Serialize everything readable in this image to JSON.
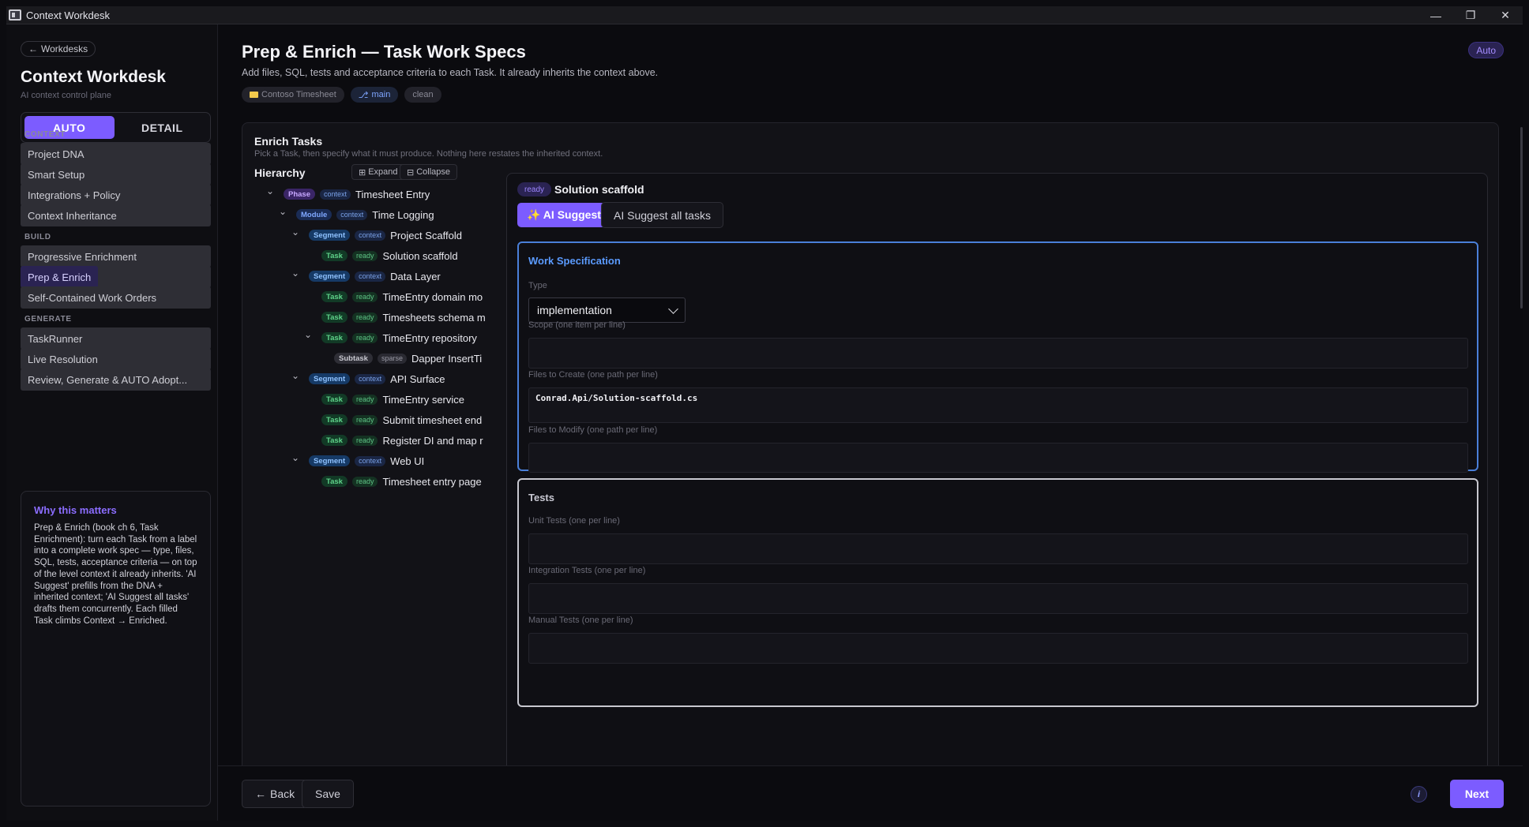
{
  "window": {
    "title": "Context Workdesk",
    "controls": [
      "—",
      "❐",
      "✕"
    ]
  },
  "sidebar": {
    "back_label": "Workdesks",
    "title": "Context Workdesk",
    "subtitle": "AI context control plane",
    "modes": [
      "AUTO",
      "DETAIL"
    ],
    "active_mode": "AUTO",
    "sections": [
      {
        "label": "CONTEXT",
        "items": [
          "Project DNA",
          "Smart Setup",
          "Integrations + Policy",
          "Context Inheritance"
        ]
      },
      {
        "label": "BUILD",
        "items": [
          "Progressive Enrichment",
          "Prep & Enrich",
          "Self-Contained Work Orders"
        ]
      },
      {
        "label": "GENERATE",
        "items": [
          "TaskRunner",
          "Live Resolution",
          "Review, Generate & AUTO Adopt..."
        ]
      }
    ],
    "active_item": "Prep & Enrich",
    "why": {
      "title": "Why this matters",
      "text": "Prep & Enrich (book ch 6, Task Enrichment): turn each Task from a label into a complete work spec — type, files, SQL, tests, acceptance criteria — on top of the level context it already inherits. 'AI Suggest' prefills from the DNA + inherited context; 'AI Suggest all tasks' drafts them concurrently. Each filled Task climbs Context → Enriched."
    }
  },
  "header": {
    "title": "Prep & Enrich — Task Work Specs",
    "subtitle": "Add files, SQL, tests and acceptance criteria to each Task. It already inherits the context above.",
    "chips": {
      "project": "Contoso Timesheet",
      "branch": "main",
      "status": "clean"
    },
    "mode_badge": "Auto"
  },
  "enrich": {
    "title": "Enrich Tasks",
    "subtitle": "Pick a Task, then specify what it must produce. Nothing here restates the inherited context.",
    "hierarchy_label": "Hierarchy",
    "expand_label": "Expand",
    "collapse_label": "Collapse",
    "tree": [
      {
        "kind": "Phase",
        "state": "context",
        "label": "Timesheet Entry",
        "depth": 0,
        "chevron": true
      },
      {
        "kind": "Module",
        "state": "context",
        "label": "Time Logging",
        "depth": 1,
        "chevron": true
      },
      {
        "kind": "Segment",
        "state": "context",
        "label": "Project Scaffold",
        "depth": 2,
        "chevron": true
      },
      {
        "kind": "Task",
        "state": "ready",
        "label": "Solution scaffold",
        "depth": 3,
        "chevron": false
      },
      {
        "kind": "Segment",
        "state": "context",
        "label": "Data Layer",
        "depth": 2,
        "chevron": true
      },
      {
        "kind": "Task",
        "state": "ready",
        "label": "TimeEntry domain mo",
        "depth": 3,
        "chevron": false
      },
      {
        "kind": "Task",
        "state": "ready",
        "label": "Timesheets schema m",
        "depth": 3,
        "chevron": false
      },
      {
        "kind": "Task",
        "state": "ready",
        "label": "TimeEntry repository",
        "depth": 3,
        "chevron": true
      },
      {
        "kind": "Subtask",
        "state": "sparse",
        "label": "Dapper InsertTi",
        "depth": 4,
        "chevron": false
      },
      {
        "kind": "Segment",
        "state": "context",
        "label": "API Surface",
        "depth": 2,
        "chevron": true
      },
      {
        "kind": "Task",
        "state": "ready",
        "label": "TimeEntry service",
        "depth": 3,
        "chevron": false
      },
      {
        "kind": "Task",
        "state": "ready",
        "label": "Submit timesheet end",
        "depth": 3,
        "chevron": false
      },
      {
        "kind": "Task",
        "state": "ready",
        "label": "Register DI and map r",
        "depth": 3,
        "chevron": false
      },
      {
        "kind": "Segment",
        "state": "context",
        "label": "Web UI",
        "depth": 2,
        "chevron": true
      },
      {
        "kind": "Task",
        "state": "ready",
        "label": "Timesheet entry page",
        "depth": 3,
        "chevron": false
      }
    ]
  },
  "detail": {
    "status": "ready",
    "title": "Solution scaffold",
    "ai_suggest_label": "✨ AI Suggest",
    "ai_suggest_all_label": "AI Suggest all tasks",
    "spec": {
      "title": "Work Specification",
      "type_label": "Type",
      "type_value": "implementation",
      "scope_label": "Scope (one item per line)",
      "scope_value": "",
      "create_label": "Files to Create (one path per line)",
      "create_value": "Conrad.Api/Solution-scaffold.cs",
      "modify_label": "Files to Modify (one path per line)",
      "modify_value": ""
    },
    "tests": {
      "title": "Tests",
      "unit_label": "Unit Tests (one per line)",
      "integration_label": "Integration Tests (one per line)",
      "manual_label": "Manual Tests (one per line)"
    }
  },
  "footer": {
    "back_label": "Back",
    "save_label": "Save",
    "info_label": "i",
    "next_label": "Next"
  },
  "colors": {
    "accent": "#7c5cff",
    "spec_border": "#4a7fd9",
    "background": "#0b0b0f"
  }
}
